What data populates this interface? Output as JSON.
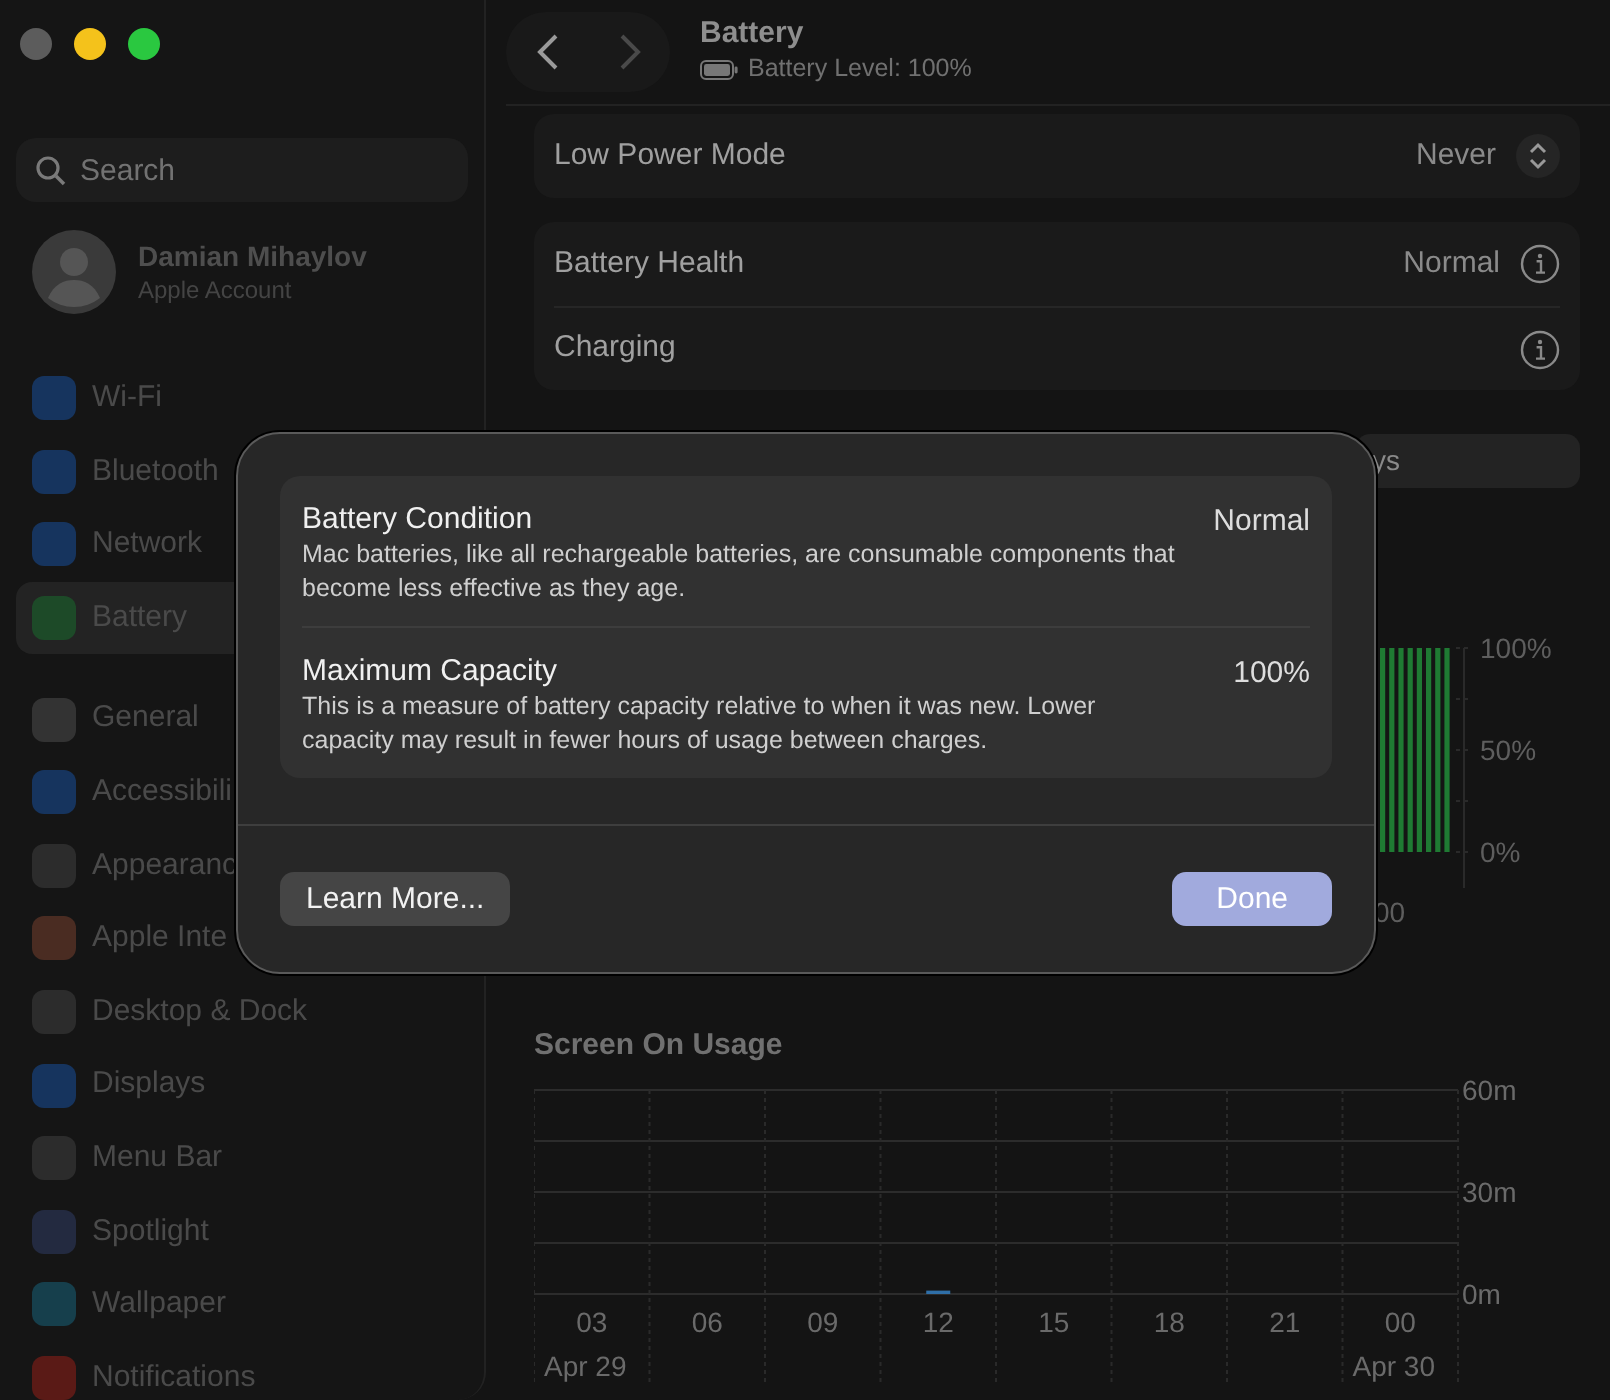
{
  "window": {
    "traffic_lights": [
      {
        "color": "#5c5c5c"
      },
      {
        "color": "#f4c21b"
      },
      {
        "color": "#2ac840"
      }
    ]
  },
  "sidebar": {
    "search": {
      "placeholder": "Search"
    },
    "account": {
      "name": "Damian Mihaylov",
      "subtitle": "Apple Account"
    },
    "groups": [
      {
        "items": [
          {
            "label": "Wi-Fi",
            "color": "#16345e",
            "selected": false
          },
          {
            "label": "Bluetooth",
            "color": "#16345e",
            "selected": false
          },
          {
            "label": "Network",
            "color": "#16345e",
            "selected": false
          },
          {
            "label": "Battery",
            "color": "#1d4a28",
            "selected": true
          }
        ]
      },
      {
        "items": [
          {
            "label": "General",
            "color": "#333333",
            "selected": false
          },
          {
            "label": "Accessibili",
            "color": "#16345e",
            "selected": false
          },
          {
            "label": "Appearanc",
            "color": "#2c2c2c",
            "selected": false
          },
          {
            "label": "Apple Inte",
            "color": "#4a2c22",
            "selected": false
          },
          {
            "label": "Desktop & Dock",
            "color": "#2c2c2c",
            "selected": false
          },
          {
            "label": "Displays",
            "color": "#16345e",
            "selected": false
          },
          {
            "label": "Menu Bar",
            "color": "#2c2c2c",
            "selected": false
          },
          {
            "label": "Spotlight",
            "color": "#232a40",
            "selected": false
          },
          {
            "label": "Wallpaper",
            "color": "#163f4c",
            "selected": false
          },
          {
            "label": "Notifications",
            "color": "#5a1a16",
            "selected": false
          }
        ]
      }
    ]
  },
  "header": {
    "title": "Battery",
    "subtitle": "Battery Level: 100%"
  },
  "settings": [
    {
      "rows": [
        {
          "label": "Low Power Mode",
          "value": "Never",
          "kind": "popup"
        }
      ]
    },
    {
      "rows": [
        {
          "label": "Battery Health",
          "value": "Normal",
          "kind": "info"
        },
        {
          "label": "Charging",
          "kind": "info"
        }
      ]
    }
  ],
  "range_segment": {
    "label": "ys"
  },
  "battery_chart": {
    "y_labels": [
      "100%",
      "50%",
      "0%"
    ],
    "x_label": "00"
  },
  "screen_usage": {
    "title": "Screen On Usage",
    "dates": [
      "Apr 29",
      "Apr 30"
    ],
    "chart_data": {
      "type": "bar",
      "categories": [
        "03",
        "06",
        "09",
        "12",
        "15",
        "18",
        "21",
        "00"
      ],
      "values": [
        0,
        0,
        0,
        1,
        0,
        0,
        0,
        0
      ],
      "ylim": [
        0,
        60
      ],
      "yticks": [
        {
          "value": 0,
          "label": "0m"
        },
        {
          "value": 30,
          "label": "30m"
        },
        {
          "value": 60,
          "label": "60m"
        }
      ]
    }
  },
  "dialog": {
    "items": [
      {
        "title": "Battery Condition",
        "value": "Normal",
        "description": "Mac batteries, like all rechargeable batteries, are consumable components that become less effective as they age."
      },
      {
        "title": "Maximum Capacity",
        "value": "100%",
        "description": "This is a measure of battery capacity relative to when it was new. Lower capacity may result in fewer hours of usage between charges."
      }
    ],
    "buttons": [
      {
        "label": "Learn More...",
        "kind": "secondary"
      },
      {
        "label": "Done",
        "kind": "primary"
      }
    ]
  }
}
